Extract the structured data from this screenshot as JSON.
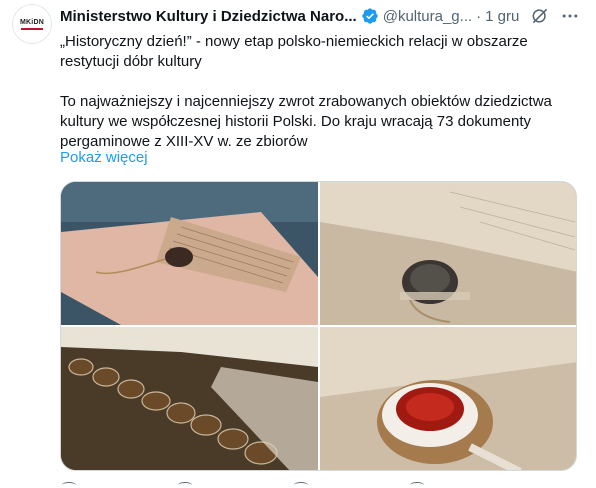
{
  "account": {
    "avatar_text": "MKiDN",
    "display_name": "Ministerstwo Kultury i Dziedzictwa Naro...",
    "handle": "@kultura_g...",
    "separator": "·",
    "time": "1 gru"
  },
  "tweet": {
    "line1": "„Historyczny dzień!” - nowy etap polsko-niemieckich relacji w obszarze restytucji dóbr kultury",
    "line2": "To najważniejszy i najcenniejszy zwrot zrabowanych obiektów dziedzictwa kultury we współczesnej historii Polski. Do kraju wracają 73 dokumenty pergaminowe z XIII-XV w. ze zbiorów",
    "show_more": "Pokaż więcej"
  },
  "media": {
    "photos": [
      "document-with-seal",
      "parchment-with-seal",
      "stacked-seals",
      "red-wax-seal"
    ]
  },
  "colors": {
    "link": "#1d9bf0",
    "verified": "#1d9bf0",
    "muted": "#536471"
  }
}
